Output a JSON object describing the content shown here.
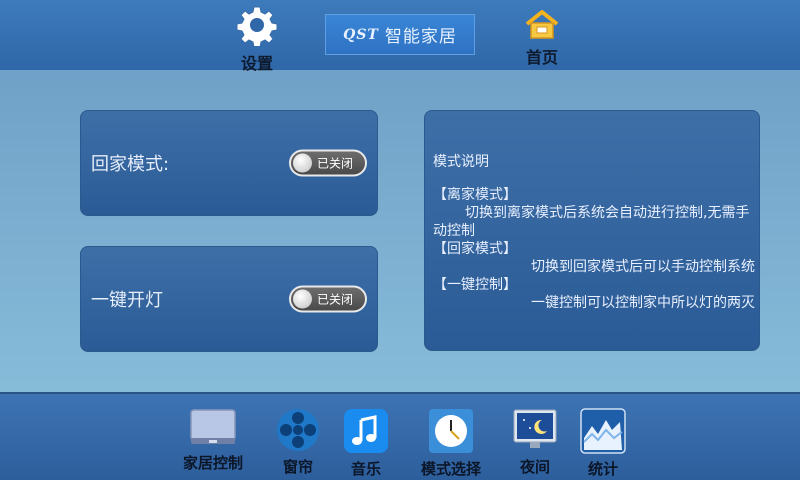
{
  "header": {
    "settings_label": "设置",
    "home_label": "首页",
    "logo_brand": "QST",
    "logo_text": "智能家居"
  },
  "modes": [
    {
      "label": "回家模式:",
      "toggle_state": "已关闭"
    },
    {
      "label": "一键开灯",
      "toggle_state": "已关闭"
    }
  ],
  "description": {
    "title": "模式说明",
    "sections": [
      {
        "heading": "【离家模式】",
        "text": "切换到离家模式后系统会自动进行控制,无需手动控制"
      },
      {
        "heading": "【回家模式】",
        "text": "切换到回家模式后可以手动控制系统"
      },
      {
        "heading": "【一键控制】",
        "text": "一键控制可以控制家中所以灯的两灭"
      }
    ]
  },
  "bottom_nav": [
    {
      "label": "家居控制",
      "icon": "monitor-icon"
    },
    {
      "label": "窗帘",
      "icon": "curtain-reel-icon"
    },
    {
      "label": "音乐",
      "icon": "music-note-icon"
    },
    {
      "label": "模式选择",
      "icon": "clock-icon"
    },
    {
      "label": "夜间",
      "icon": "night-screen-icon"
    },
    {
      "label": "统计",
      "icon": "chart-icon"
    }
  ]
}
